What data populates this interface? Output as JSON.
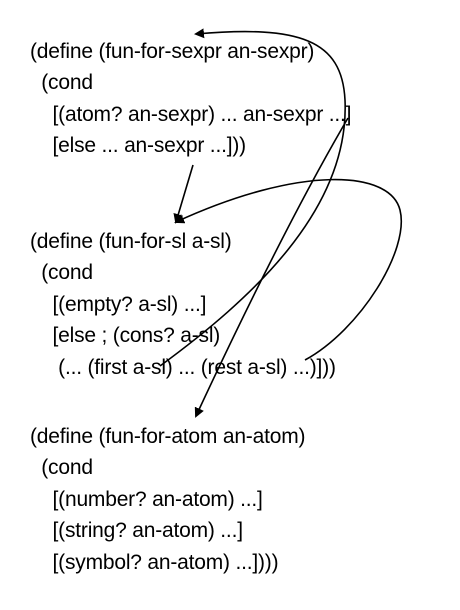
{
  "blocks": [
    {
      "name": "sexpr-template",
      "lines": [
        "(define (fun-for-sexpr an-sexpr)",
        "  (cond",
        "    [(atom? an-sexpr) ... an-sexpr ...]",
        "    [else ... an-sexpr ...]))"
      ]
    },
    {
      "name": "sl-template",
      "lines": [
        "(define (fun-for-sl a-sl)",
        "  (cond",
        "    [(empty? a-sl) ...]",
        "    [else ; (cons? a-sl)",
        "     (... (first a-sl) ... (rest a-sl) ...)]))"
      ]
    },
    {
      "name": "atom-template",
      "lines": [
        "(define (fun-for-atom an-atom)",
        "  (cond",
        "    [(number? an-atom) ...]",
        "    [(string? an-atom) ...]",
        "    [(symbol? an-atom) ...])))"
      ]
    }
  ]
}
